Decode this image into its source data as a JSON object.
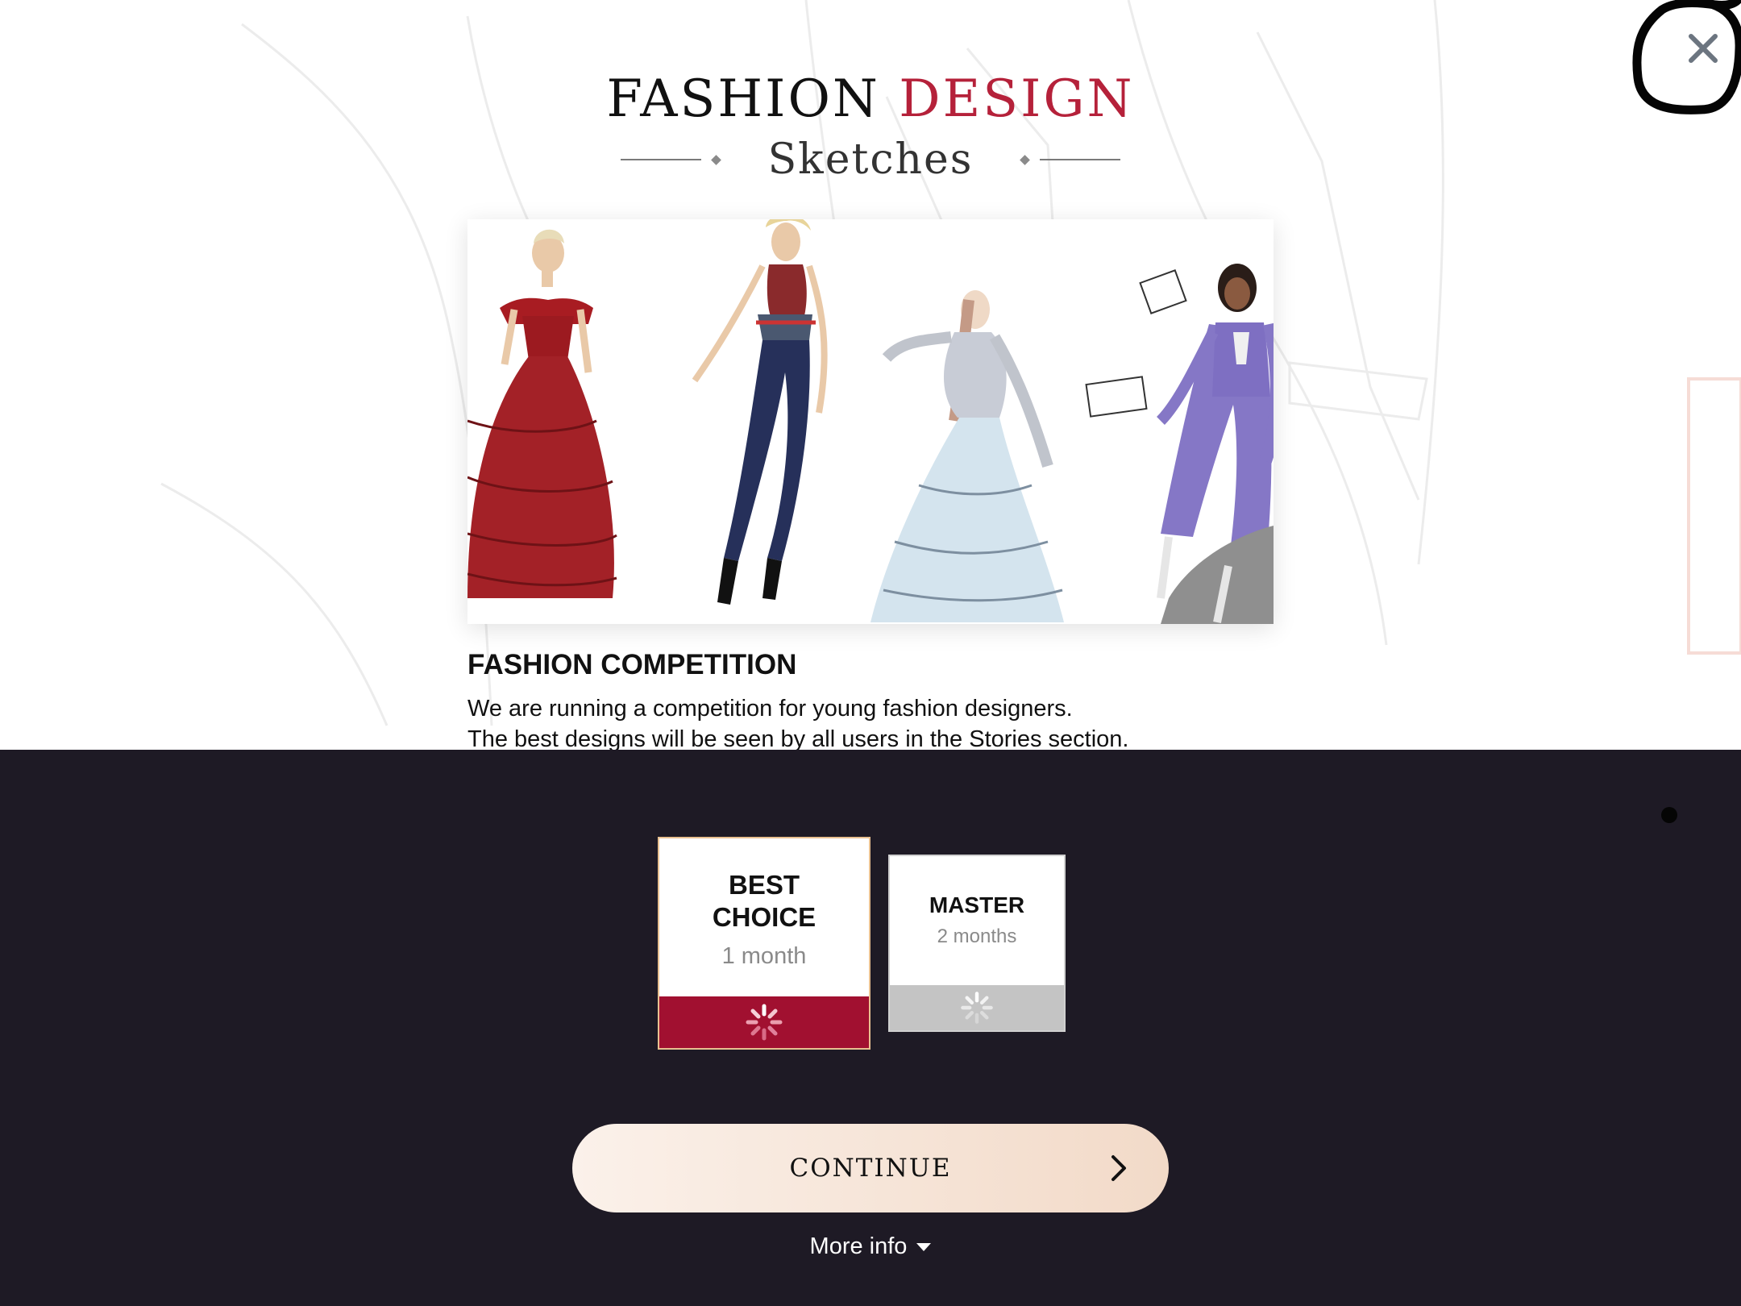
{
  "logo": {
    "line1_a": "FASHION",
    "line1_b": "DESIGN",
    "line2": "Sketches"
  },
  "close_icon": "close-icon",
  "hero": {
    "icon": "fashion-sketches-illustration"
  },
  "competition": {
    "title": "FASHION COMPETITION",
    "line1": "We are running a competition for young fashion designers.",
    "line2": "The best designs will be seen by all users in the Stories section."
  },
  "plans": [
    {
      "name_line1": "BEST",
      "name_line2": "CHOICE",
      "duration": "1 month",
      "status_icon": "loading-spinner-icon",
      "selected": true
    },
    {
      "name": "MASTER",
      "duration": "2 months",
      "status_icon": "loading-spinner-icon",
      "selected": false
    }
  ],
  "continue_button": {
    "label": "CONTINUE",
    "icon": "chevron-right-icon"
  },
  "more_info": {
    "label": "More info",
    "icon": "caret-down-icon"
  },
  "colors": {
    "accent": "#b5213a",
    "panel_bg": "#1e1a25",
    "best_choice_footer": "#a11030",
    "master_footer": "#c4c4c4",
    "continue_gradient_start": "#fbf1ea",
    "continue_gradient_end": "#f2dac8"
  }
}
